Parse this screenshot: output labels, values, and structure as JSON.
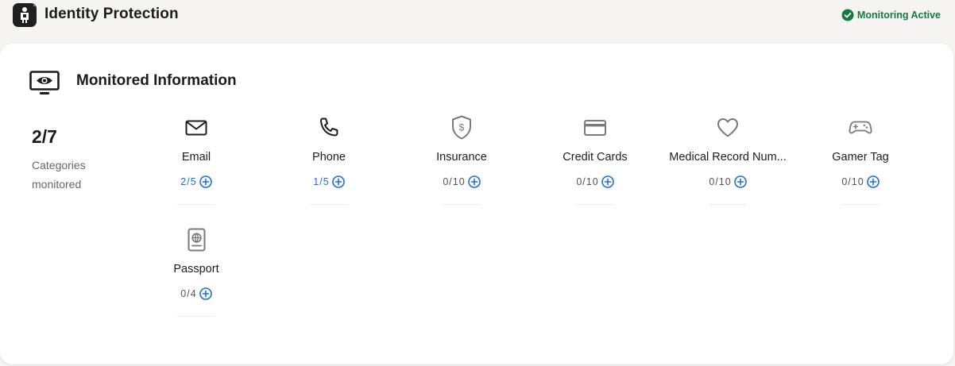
{
  "header": {
    "app_title": "Identity Protection",
    "status_label": "Monitoring Active",
    "status_color": "#147a3e",
    "logo_icon": "identity-guard-icon"
  },
  "monitored": {
    "title": "Monitored Information",
    "section_icon": "monitor-eye-icon",
    "summary": {
      "count": "2/7",
      "label": "Categories monitored"
    },
    "accent_color": "#1f6fd1",
    "categories": [
      {
        "label": "Email",
        "count": "2/5",
        "icon": "envelope-icon",
        "active": true
      },
      {
        "label": "Phone",
        "count": "1/5",
        "icon": "phone-icon",
        "active": true
      },
      {
        "label": "Insurance",
        "count": "0/10",
        "icon": "shield-dollar-icon",
        "active": false
      },
      {
        "label": "Credit Cards",
        "count": "0/10",
        "icon": "credit-card-icon",
        "active": false
      },
      {
        "label": "Medical Record Num...",
        "count": "0/10",
        "icon": "heart-icon",
        "active": false
      },
      {
        "label": "Gamer Tag",
        "count": "0/10",
        "icon": "gamepad-icon",
        "active": false
      },
      {
        "label": "Passport",
        "count": "0/4",
        "icon": "passport-icon",
        "active": false
      }
    ]
  }
}
